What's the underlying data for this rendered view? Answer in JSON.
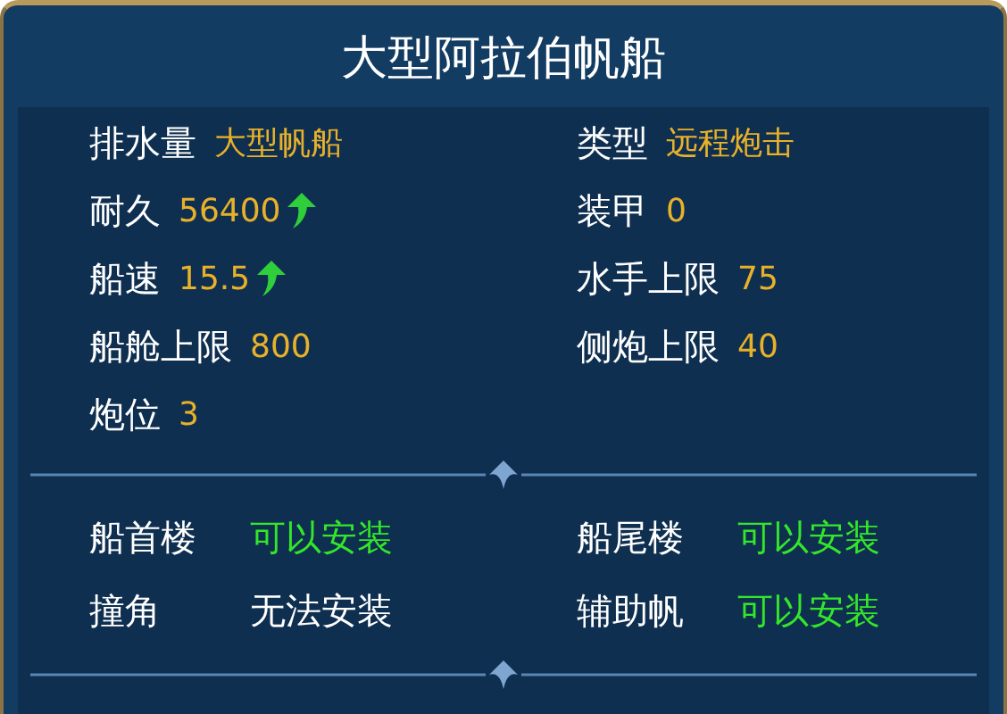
{
  "title": "大型阿拉伯帆船",
  "stats": [
    {
      "label": "排水量",
      "value": "大型帆船",
      "boosted": false
    },
    {
      "label": "类型",
      "value": "远程炮击",
      "boosted": false
    },
    {
      "label": "耐久",
      "value": "56400",
      "boosted": true
    },
    {
      "label": "装甲",
      "value": "0",
      "boosted": false
    },
    {
      "label": "船速",
      "value": "15.5",
      "boosted": true
    },
    {
      "label": "水手上限",
      "value": "75",
      "boosted": false
    },
    {
      "label": "船舱上限",
      "value": "800",
      "boosted": false
    },
    {
      "label": "侧炮上限",
      "value": "40",
      "boosted": false
    },
    {
      "label": "炮位",
      "value": "3",
      "boosted": false
    }
  ],
  "slots": [
    {
      "label": "船首楼",
      "value": "可以安装",
      "installable": true
    },
    {
      "label": "船尾楼",
      "value": "可以安装",
      "installable": true
    },
    {
      "label": "撞角",
      "value": "无法安装",
      "installable": false
    },
    {
      "label": "辅助帆",
      "value": "可以安装",
      "installable": true
    }
  ]
}
